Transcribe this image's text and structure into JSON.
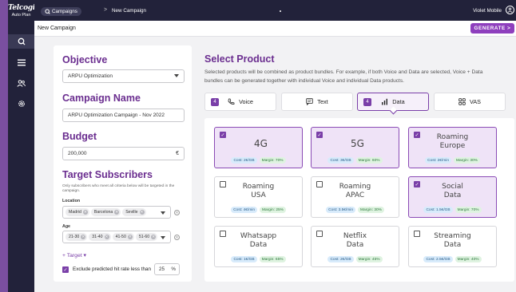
{
  "app": {
    "logo_line1": "Telcogi",
    "logo_line2": "Auto Plan"
  },
  "topbar": {
    "crumb_root": "Campaigns",
    "crumb_sep": ">",
    "crumb_current": "New Campaign",
    "user_name": "Violet Mobile"
  },
  "header": {
    "title": "New Campaign",
    "generate_label": "GENERATE >"
  },
  "sidebar": {
    "icons": [
      "campaigns-icon",
      "list-icon",
      "users-icon",
      "settings-icon"
    ]
  },
  "form": {
    "objective_title": "Objective",
    "objective_value": "ARPU Optimization",
    "name_title": "Campaign Name",
    "name_value": "ARPU Optimization Campaign - Nov 2022",
    "budget_title": "Budget",
    "budget_value": "200,000",
    "budget_unit": "€",
    "target_title": "Target Subscribers",
    "target_note": "Only subscribers who meet all criteria below will be targeted in the campaign.",
    "location_label": "Location",
    "locations": [
      "Madrid",
      "Barcelona",
      "Seville"
    ],
    "age_label": "Age",
    "ages": [
      "21-30",
      "31-40",
      "41-50",
      "51-60"
    ],
    "add_target": "+ Target ▾",
    "exclude_label": "Exclude predicted hit rate less than",
    "exclude_value": "25",
    "exclude_unit": "%"
  },
  "products": {
    "title": "Select Product",
    "description": "Selected products will be combined as product bundles. For example, if both Voice and Data are selected, Voice + Data bundles can be generated together with individual Voice and individual Data products.",
    "tabs": [
      {
        "label": "Voice",
        "badge": "4",
        "active": false
      },
      {
        "label": "Text",
        "badge": "",
        "active": false
      },
      {
        "label": "Data",
        "badge": "4",
        "active": true
      },
      {
        "label": "VAS",
        "badge": "",
        "active": false
      }
    ],
    "cards": [
      {
        "name": "4G",
        "cost": "Cost: 2€/GB",
        "margin": "Margin: 70%",
        "selected": true
      },
      {
        "name": "5G",
        "cost": "Cost: 3€/GB",
        "margin": "Margin: 60%",
        "selected": true
      },
      {
        "name": "Roaming Europe",
        "cost": "Cost: 2€/min",
        "margin": "Margin: 30%",
        "selected": true
      },
      {
        "name": "Roaming USA",
        "cost": "Cost: 4€/min",
        "margin": "Margin: 25%",
        "selected": false
      },
      {
        "name": "Roaming APAC",
        "cost": "Cost: 3.5€/min",
        "margin": "Margin: 30%",
        "selected": false
      },
      {
        "name": "Social Data",
        "cost": "Cost: 1.5€/GB",
        "margin": "Margin: 70%",
        "selected": true
      },
      {
        "name": "Whatsapp Data",
        "cost": "Cost: 1€/GB",
        "margin": "Margin: 65%",
        "selected": false
      },
      {
        "name": "Netflix Data",
        "cost": "Cost: 2€/GB",
        "margin": "Margin: 45%",
        "selected": false
      },
      {
        "name": "Streaming Data",
        "cost": "Cost: 2.5€/GB",
        "margin": "Margin: 40%",
        "selected": false
      }
    ]
  },
  "colors": {
    "accent": "#7a3fa8",
    "sidebar": "#22223a",
    "generate": "#8e3fbd"
  }
}
